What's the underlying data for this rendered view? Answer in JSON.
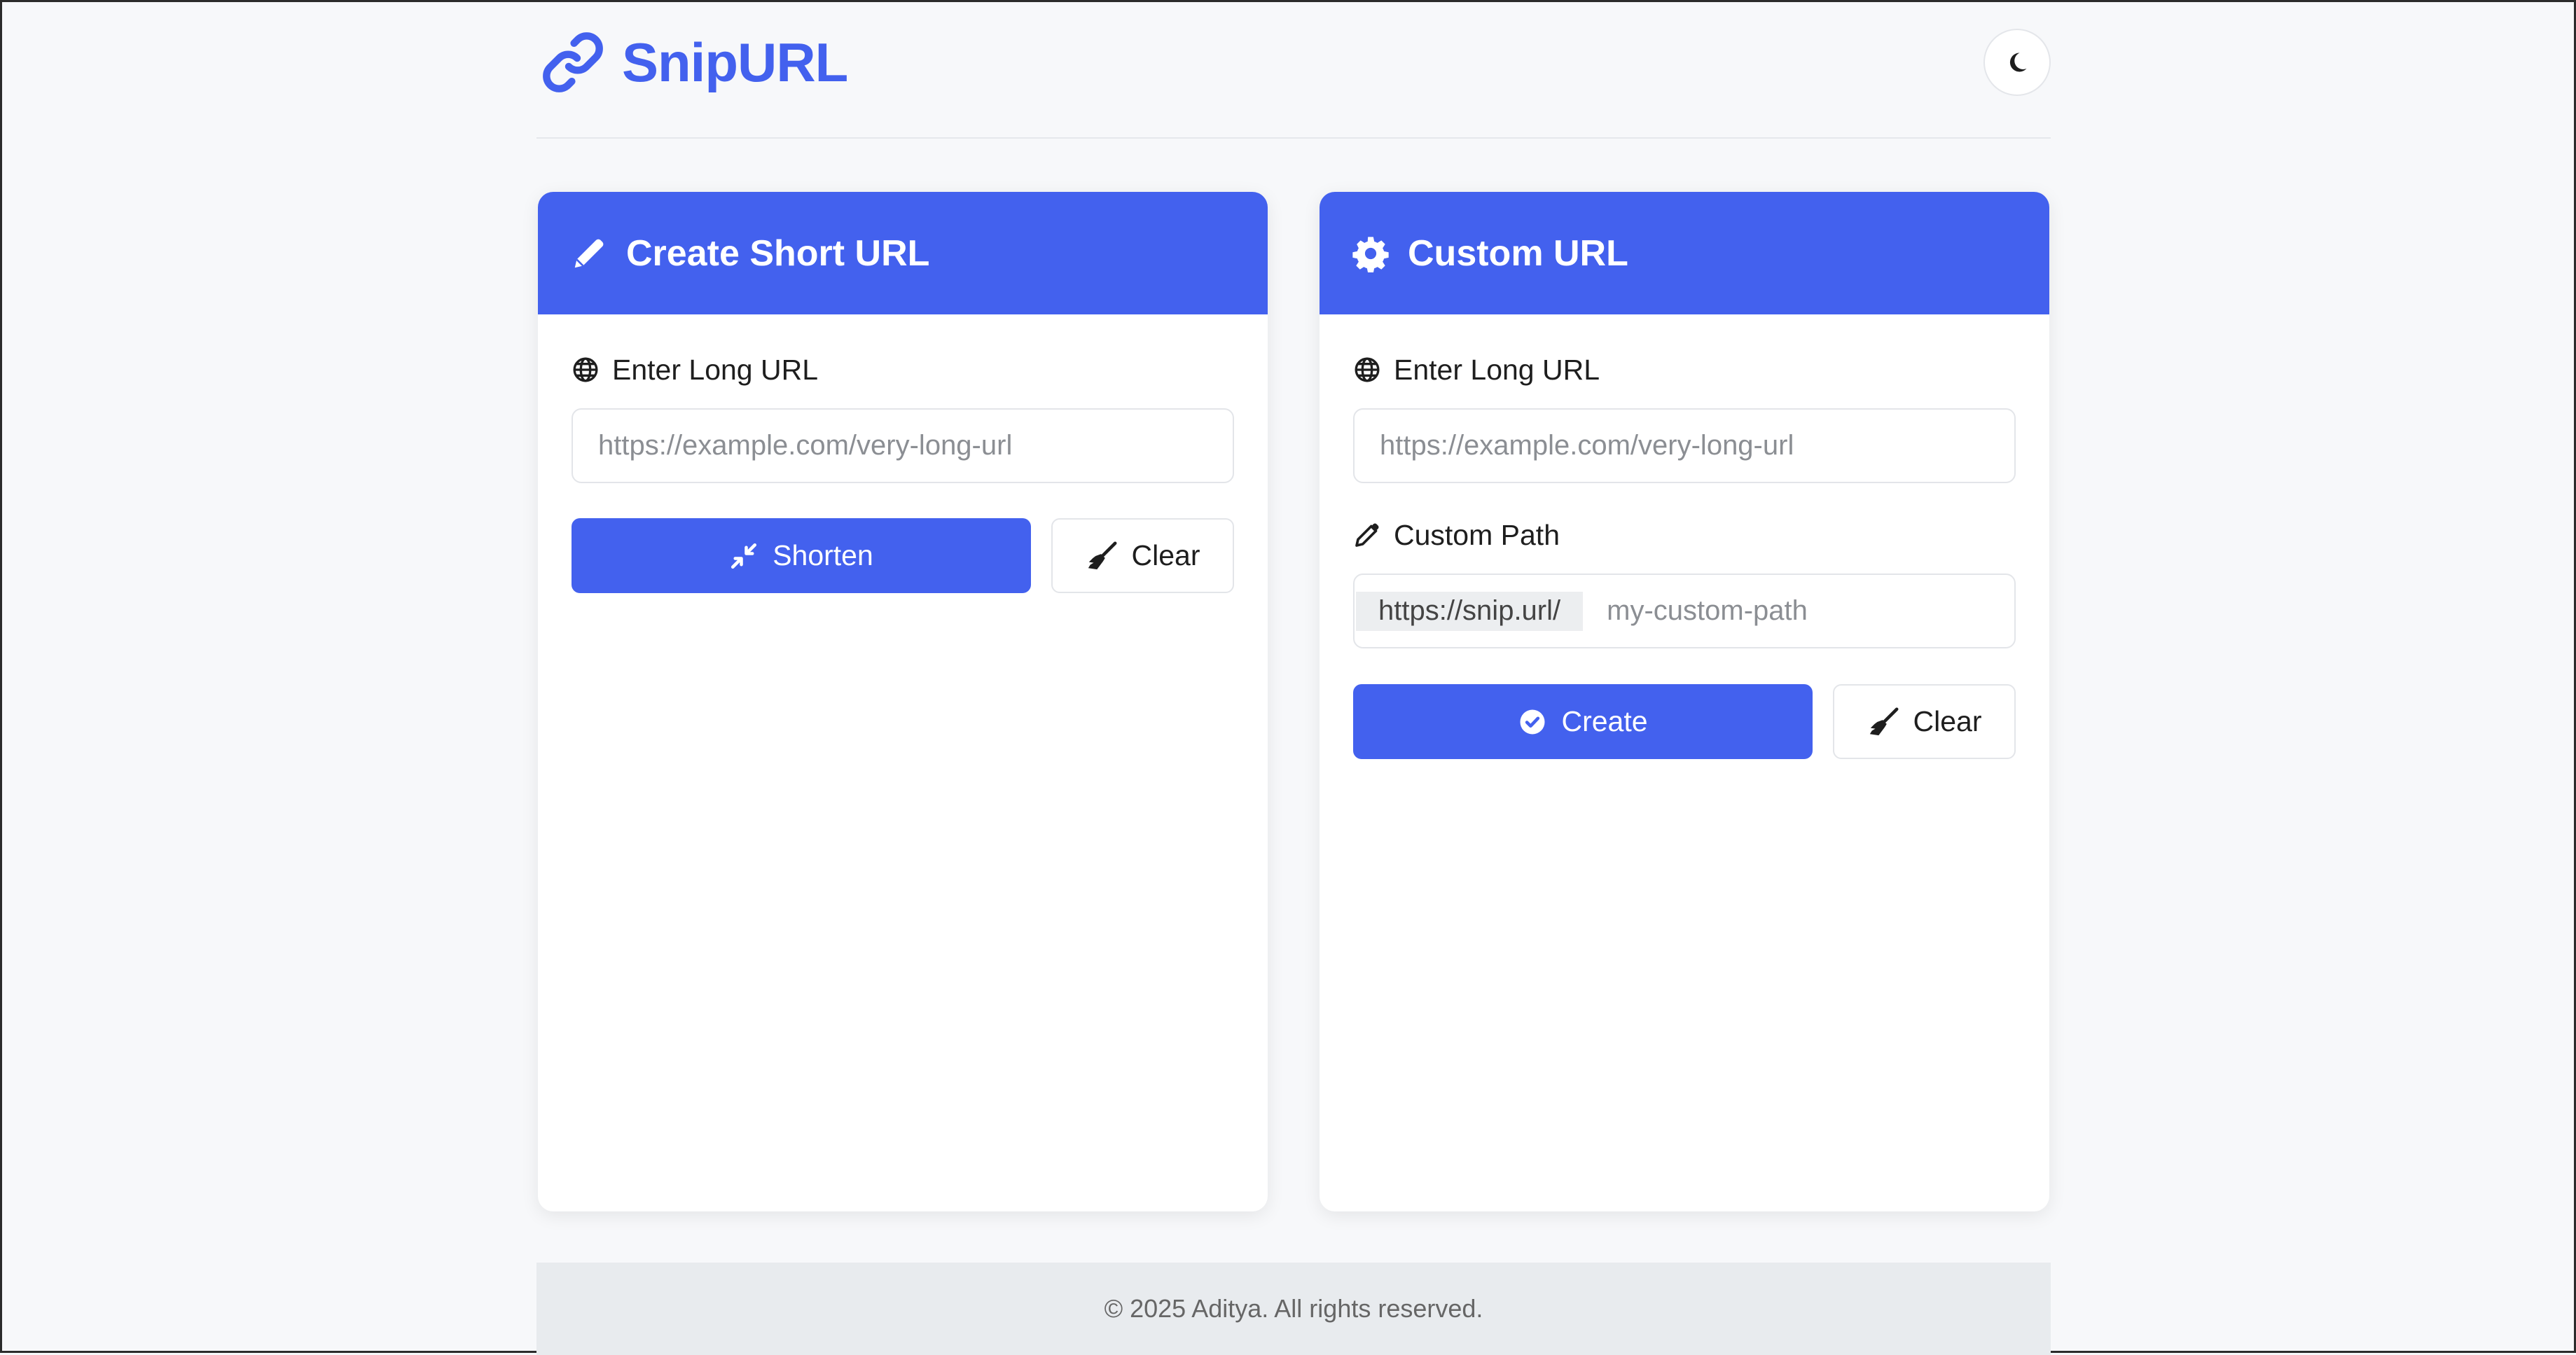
{
  "app": {
    "name": "SnipURL",
    "accent_color": "#4361ee",
    "logo_icon": "link-icon",
    "theme_toggle_icon": "moon-icon"
  },
  "shorten_card": {
    "title": "Create Short URL",
    "title_icon": "pencil-icon",
    "long_url_label": "Enter Long URL",
    "long_url_icon": "globe-icon",
    "long_url_placeholder": "https://example.com/very-long-url",
    "long_url_value": "",
    "submit_label": "Shorten",
    "submit_icon": "compress-icon",
    "clear_label": "Clear",
    "clear_icon": "broom-icon"
  },
  "custom_card": {
    "title": "Custom URL",
    "title_icon": "gear-icon",
    "long_url_label": "Enter Long URL",
    "long_url_icon": "globe-icon",
    "long_url_placeholder": "https://example.com/very-long-url",
    "long_url_value": "",
    "path_label": "Custom Path",
    "path_icon": "pen-icon",
    "path_prefix": "https://snip.url/",
    "path_placeholder": "my-custom-path",
    "path_value": "",
    "submit_label": "Create",
    "submit_icon": "check-circle-icon",
    "clear_label": "Clear",
    "clear_icon": "broom-icon"
  },
  "footer": {
    "text": "© 2025 Aditya. All rights reserved."
  }
}
